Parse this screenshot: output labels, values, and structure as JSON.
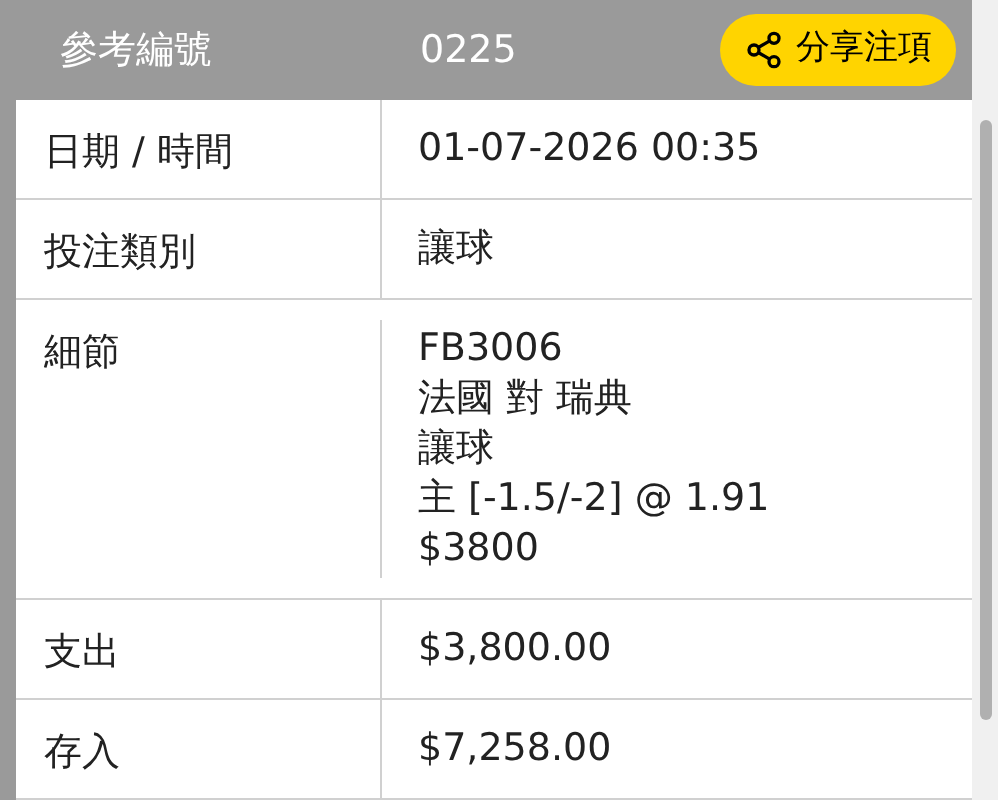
{
  "header": {
    "label": "參考編號",
    "value": "0225",
    "share_button": "分享注項"
  },
  "rows": [
    {
      "label": "日期 / 時間",
      "lines": [
        "01-07-2026 00:35"
      ]
    },
    {
      "label": "投注類別",
      "lines": [
        "讓球"
      ]
    },
    {
      "label": "細節",
      "lines": [
        "FB3006",
        "法國 對 瑞典",
        "讓球",
        "主 [-1.5/-2] @ 1.91",
        "$3800"
      ]
    },
    {
      "label": "支出",
      "lines": [
        "$3,800.00"
      ]
    },
    {
      "label": "存入",
      "lines": [
        "$7,258.00"
      ]
    }
  ]
}
